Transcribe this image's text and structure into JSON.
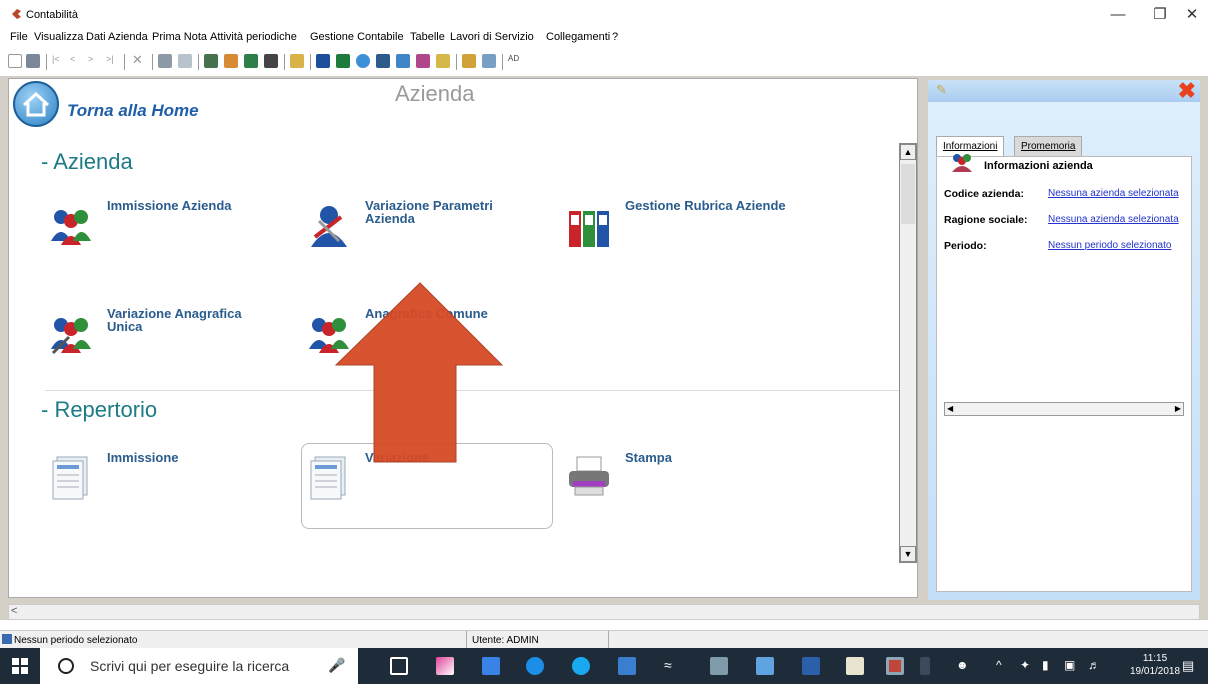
{
  "window": {
    "title": "Contabilità"
  },
  "menu": [
    "File",
    "Visualizza",
    "Dati Azienda",
    "Prima Nota",
    "Attività periodiche",
    "Gestione Contabile",
    "Tabelle",
    "Lavori di Servizio",
    "Collegamenti",
    "?"
  ],
  "home": {
    "label": "Torna alla Home"
  },
  "page_heading": "Azienda",
  "sections": {
    "azienda": {
      "title": "- Azienda",
      "items": [
        "Immissione Azienda",
        "Variazione Parametri Azienda",
        "Gestione Rubrica Aziende",
        "Variazione Anagrafica Unica",
        "Anagrafica Comune"
      ]
    },
    "repertorio": {
      "title": "- Repertorio",
      "items": [
        "Immissione",
        "Variazione",
        "Stampa"
      ]
    }
  },
  "panel": {
    "tabs": [
      "Informazioni",
      "Promemoria"
    ],
    "title": "Informazioni azienda",
    "rows": [
      {
        "label": "Codice azienda:",
        "value": "Nessuna azienda selezionata"
      },
      {
        "label": "Ragione sociale:",
        "value": "Nessuna azienda selezionata"
      },
      {
        "label": "Periodo:",
        "value": "Nessun periodo selezionato"
      }
    ]
  },
  "status": {
    "left": "Nessun periodo selezionato",
    "user": "Utente: ADMIN"
  },
  "taskbar": {
    "search_placeholder": "Scrivi qui per eseguire la ricerca",
    "time": "11:15",
    "date": "19/01/2018"
  },
  "colors": {
    "accent": "#1f5fa8",
    "section": "#1d7b85",
    "arrow": "#d64a25"
  }
}
